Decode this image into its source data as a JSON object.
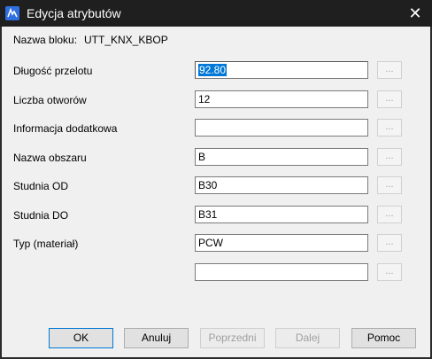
{
  "window": {
    "title": "Edycja atrybutów"
  },
  "block": {
    "label": "Nazwa bloku:",
    "value": "UTT_KNX_KBOP"
  },
  "rows": [
    {
      "label": "Długość przelotu",
      "value": "92.80",
      "button": "..."
    },
    {
      "label": "Liczba otworów",
      "value": "12",
      "button": "..."
    },
    {
      "label": "Informacja dodatkowa",
      "value": "",
      "button": "..."
    },
    {
      "label": "Nazwa obszaru",
      "value": "B",
      "button": "..."
    },
    {
      "label": "Studnia OD",
      "value": "B30",
      "button": "..."
    },
    {
      "label": "Studnia DO",
      "value": "B31",
      "button": "..."
    },
    {
      "label": "Typ (materiał)",
      "value": "PCW",
      "button": "..."
    },
    {
      "label": "",
      "value": "",
      "button": "..."
    }
  ],
  "buttons": {
    "ok": "OK",
    "cancel": "Anuluj",
    "prev": "Poprzedni",
    "next": "Dalej",
    "help": "Pomoc"
  }
}
